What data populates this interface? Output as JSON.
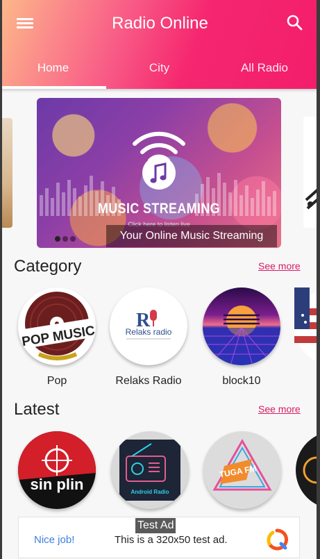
{
  "app_bar": {
    "title": "Radio Online",
    "menu_icon": "hamburger-menu-icon",
    "search_icon": "search-icon",
    "gradient": [
      "#fcb98a",
      "#f85a86",
      "#f31d6b"
    ]
  },
  "tabs": [
    {
      "label": "Home",
      "selected": true
    },
    {
      "label": "City",
      "selected": false
    },
    {
      "label": "All Radio",
      "selected": false
    }
  ],
  "carousel": {
    "banner_title": "MUSIC STREAMING",
    "banner_subtitle": "Click here to listen live",
    "caption": "Your Online Music Streaming",
    "slide_count": 3,
    "active_slide": 1
  },
  "category": {
    "title": "Category",
    "see_more": "See more",
    "items": [
      {
        "label": "Pop",
        "art_text": "POP MUSIC"
      },
      {
        "label": "Relaks Radio",
        "art_text": "Relaks radio"
      },
      {
        "label": "block10"
      }
    ]
  },
  "latest": {
    "title": "Latest",
    "see_more": "See more",
    "items": [
      {
        "art_text": "sin plin"
      },
      {
        "art_text": "Android Radio"
      },
      {
        "art_text": "TUGA FM"
      }
    ]
  },
  "ad": {
    "label": "Test Ad",
    "nice_job": "Nice job!",
    "text": "This is a 320x50 test ad."
  },
  "colors": {
    "accent": "#d81b60",
    "see_more": "#d81b60",
    "ad_nice": "#3b7fe0"
  }
}
